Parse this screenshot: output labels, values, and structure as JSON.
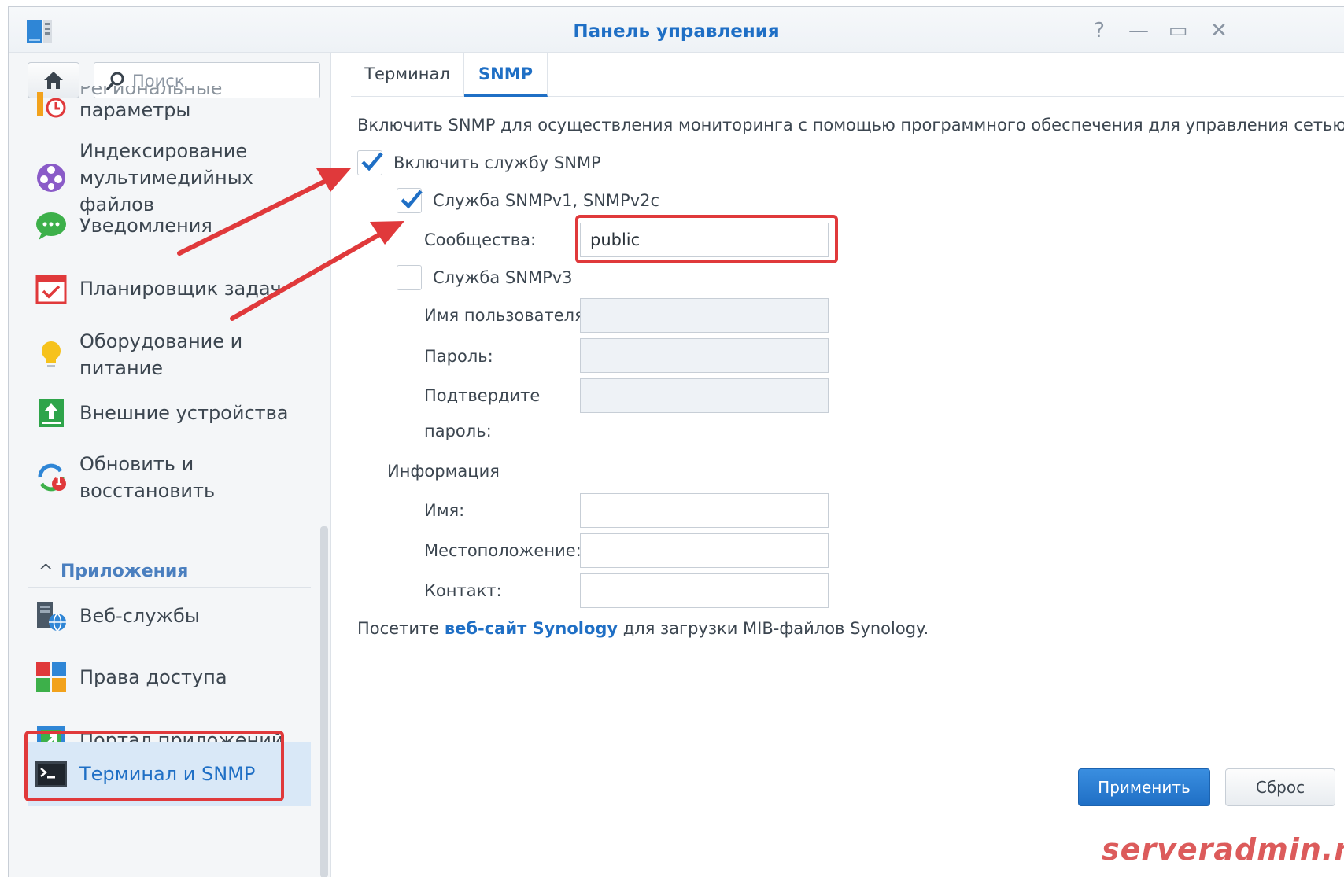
{
  "window": {
    "title": "Панель управления",
    "controls": {
      "help": "?",
      "minimize": "—",
      "maximize": "▭",
      "close": "✕"
    }
  },
  "sidebar": {
    "search_placeholder": "Поиск",
    "items": [
      {
        "label_line1": "Региональные",
        "label_line2": "параметры",
        "icon": "regional-settings-icon"
      },
      {
        "label": "Индексирование мультимедийных файлов",
        "icon": "media-indexing-icon"
      },
      {
        "label": "Уведомления",
        "icon": "notification-icon"
      },
      {
        "label": "Планировщик задач",
        "icon": "task-scheduler-icon"
      },
      {
        "label": "Оборудование и питание",
        "icon": "hardware-power-icon"
      },
      {
        "label": "Внешние устройства",
        "icon": "external-devices-icon"
      },
      {
        "label": "Обновить и восстановить",
        "icon": "update-restore-icon",
        "badge": "1"
      }
    ],
    "section_apps": "Приложения",
    "app_items": [
      {
        "label": "Веб-службы",
        "icon": "web-services-icon"
      },
      {
        "label": "Права доступа",
        "icon": "privileges-icon"
      },
      {
        "label": "Портал приложений",
        "icon": "application-portal-icon"
      },
      {
        "label": "Терминал и SNMP",
        "icon": "terminal-icon",
        "active": true
      }
    ]
  },
  "tabs": [
    {
      "label": "Терминал",
      "active": false
    },
    {
      "label": "SNMP",
      "active": true
    }
  ],
  "snmp": {
    "intro": "Включить SNMP для осуществления мониторинга с помощью программного обеспечения для управления сетью",
    "enable_label": "Включить службу SNMP",
    "enable_checked": true,
    "v1v2_label": "Служба SNMPv1, SNMPv2c",
    "v1v2_checked": true,
    "community_label": "Сообщества:",
    "community_value": "public",
    "v3_label": "Служба SNMPv3",
    "v3_checked": false,
    "username_label": "Имя пользователя:",
    "password_label": "Пароль:",
    "confirm_label_line1": "Подтвердите",
    "confirm_label_line2": "пароль:",
    "info_heading": "Информация",
    "name_label": "Имя:",
    "location_label": "Местоположение:",
    "contact_label": "Контакт:",
    "note_prefix": "Посетите ",
    "note_link": "веб-сайт Synology",
    "note_suffix": " для загрузки MIB-файлов Synology."
  },
  "buttons": {
    "apply": "Применить",
    "reset": "Сброс"
  },
  "watermark": "serveradmin.ru",
  "colors": {
    "accent": "#1f6fc5",
    "highlight": "#e0393b"
  }
}
